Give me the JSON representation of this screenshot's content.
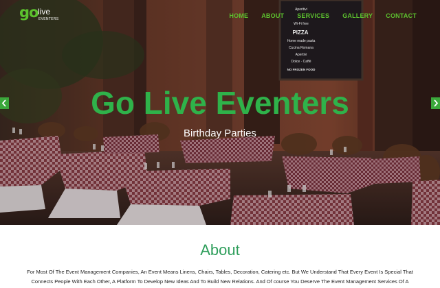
{
  "logo": {
    "go": "go",
    "live": "live",
    "tagline": "EVENTERS"
  },
  "nav": {
    "items": [
      {
        "label": "HOME"
      },
      {
        "label": "ABOUT"
      },
      {
        "label": "SERVICES"
      },
      {
        "label": "GALLERY"
      },
      {
        "label": "CONTACT"
      }
    ]
  },
  "hero": {
    "title": "Go Live Eventers",
    "subtitle": "Birthday Parties",
    "menu_board": [
      "Aperitivi",
      "Wi-Fi free",
      "PIZZA",
      "Home made pasta",
      "Cucina Romana",
      "Apertivi",
      "Dolce · Caffè",
      "NO FROZEN FOOD"
    ]
  },
  "about": {
    "heading": "About",
    "text": "For Most Of The Event Management Companies, An Event Means Linens, Chairs, Tables, Decoration, Catering etc. But We Understand That Every Event Is Special That Connects People With Each Other, A Platform To Develop New Ideas And To Build New Relations. And Of course You Deserve The Event Management Services Of A"
  },
  "colors": {
    "brand_green": "#5cc12e",
    "title_green": "#2fb24a",
    "heading_green": "#2e9e5b",
    "arrow_green": "#3ba83b"
  }
}
